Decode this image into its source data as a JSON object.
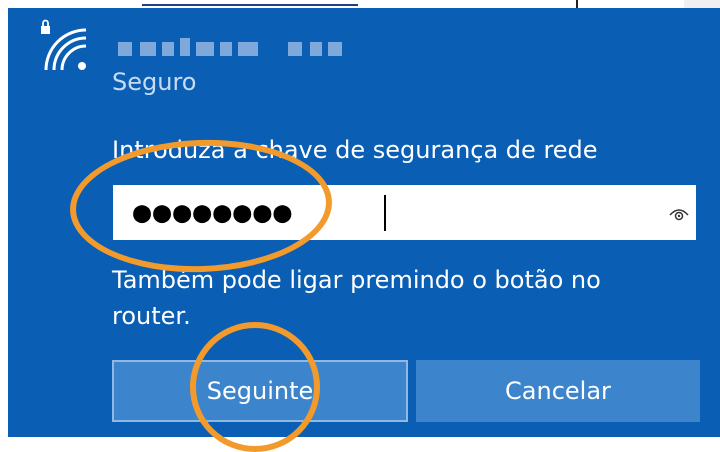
{
  "network": {
    "security_status": "Seguro",
    "icon": "wifi-secured-icon"
  },
  "connect": {
    "prompt": "Introduza a chave de segurança de rede",
    "password_value": "●●●●●●●●",
    "reveal_icon": "eye-icon",
    "hint": "Também pode ligar premindo o botão no router."
  },
  "buttons": {
    "next_label": "Seguinte",
    "cancel_label": "Cancelar"
  },
  "colors": {
    "panel_bg": "#0a5fb4",
    "button_bg": "#3c84cc",
    "highlight": "#f39a2c"
  }
}
